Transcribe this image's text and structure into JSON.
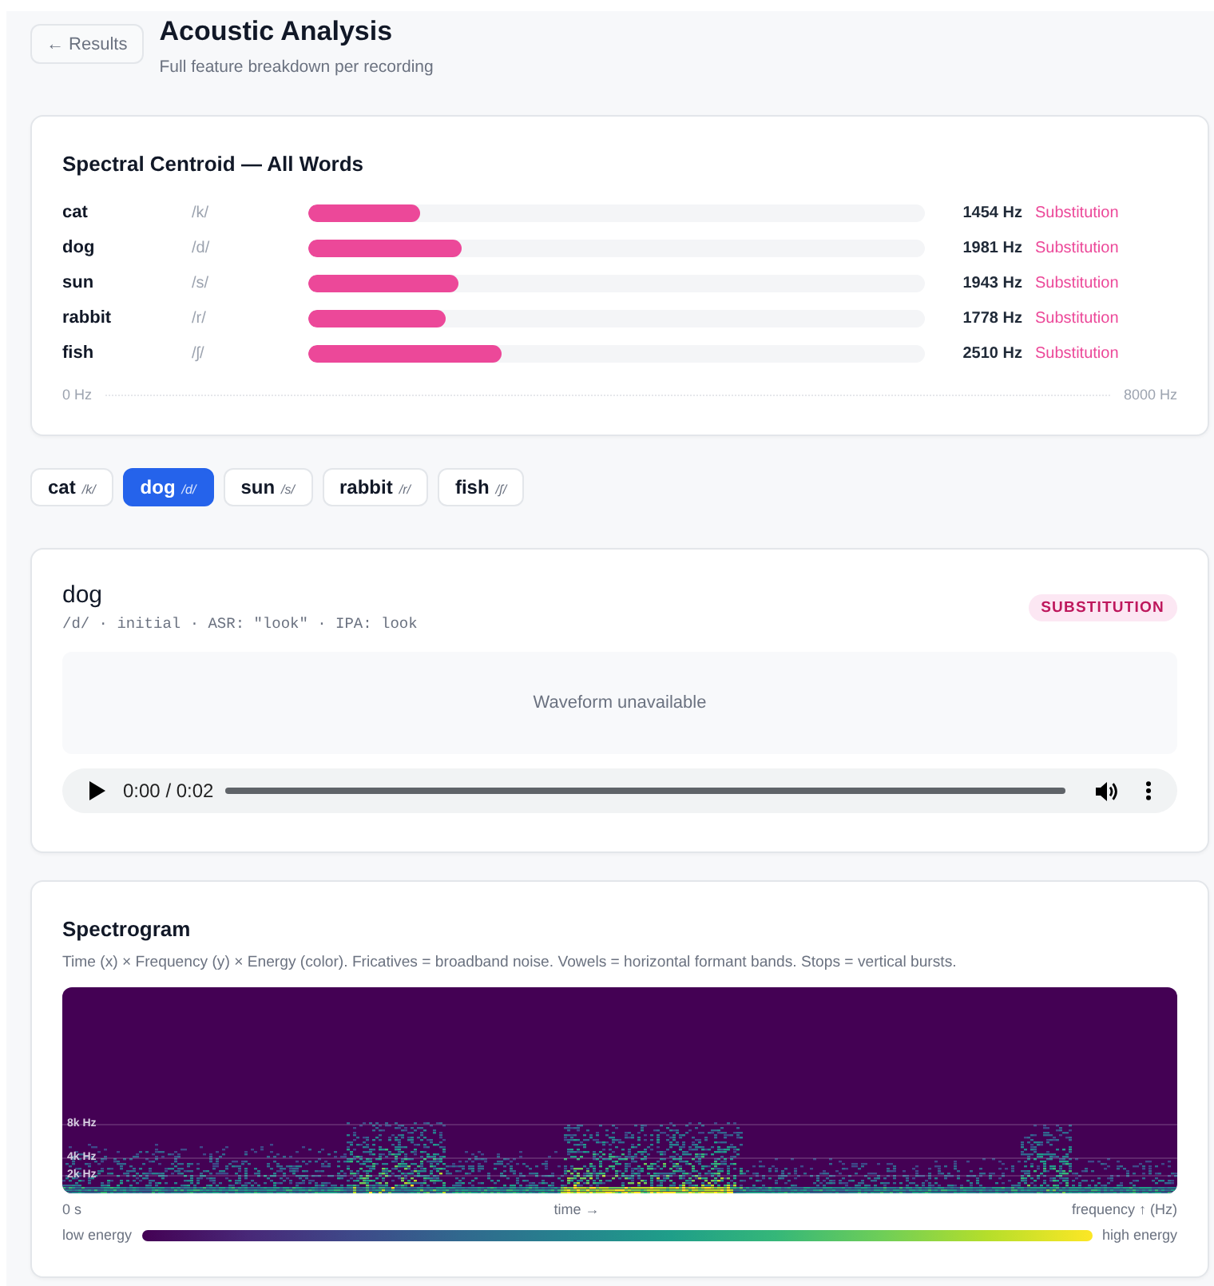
{
  "header": {
    "back_button": "← Results",
    "title": "Acoustic Analysis",
    "subtitle": "Full feature breakdown per recording"
  },
  "centroid_card": {
    "title": "Spectral Centroid — All Words",
    "rows": [
      {
        "word": "cat",
        "phoneme": "/k/",
        "level": 0.1818,
        "reading": "1454 Hz",
        "status": "Substitution"
      },
      {
        "word": "dog",
        "phoneme": "/d/",
        "level": 0.2476,
        "reading": "1981 Hz",
        "status": "Substitution"
      },
      {
        "word": "sun",
        "phoneme": "/s/",
        "level": 0.2429,
        "reading": "1943 Hz",
        "status": "Substitution"
      },
      {
        "word": "rabbit",
        "phoneme": "/r/",
        "level": 0.2223,
        "reading": "1778 Hz",
        "status": "Substitution"
      },
      {
        "word": "fish",
        "phoneme": "/ʃ/",
        "level": 0.3138,
        "reading": "2510 Hz",
        "status": "Substitution"
      }
    ],
    "axis": {
      "min_label": "0 Hz",
      "max_label": "8000 Hz"
    }
  },
  "word_tabs": [
    {
      "word": "cat",
      "phoneme": "/k/",
      "selected": false
    },
    {
      "word": "dog",
      "phoneme": "/d/",
      "selected": true
    },
    {
      "word": "sun",
      "phoneme": "/s/",
      "selected": false
    },
    {
      "word": "rabbit",
      "phoneme": "/r/",
      "selected": false
    },
    {
      "word": "fish",
      "phoneme": "/ʃ/",
      "selected": false
    }
  ],
  "detail_card": {
    "word": "dog",
    "meta": "/d/ · initial · ASR: \"look\" · IPA: look",
    "badge": "SUBSTITUTION",
    "waveform_message": "Waveform unavailable",
    "audio_player": {
      "time": "0:00 / 0:02"
    }
  },
  "spectrogram_card": {
    "title": "Spectrogram",
    "description": "Time (x) × Frequency (y) × Energy (color). Fricatives = broadband noise. Vowels = horizontal formant bands. Stops = vertical bursts.",
    "frequency_labels": [
      "8k Hz",
      "4k Hz",
      "2k Hz"
    ],
    "x_axis": {
      "start_label": "0 s",
      "center_label": "time →",
      "end_label": "frequency ↑ (Hz)"
    },
    "color_scale": {
      "low_label": "low energy",
      "high_label": "high energy"
    }
  }
}
